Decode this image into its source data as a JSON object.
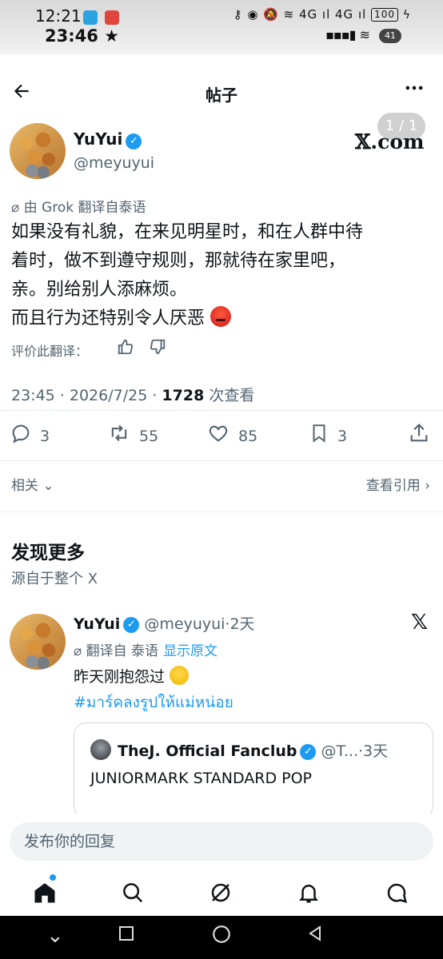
{
  "status_bar": {
    "time_primary": "12:21",
    "time_secondary": "23:46",
    "icons_top": "⚷ ◉ 🔕 ≋ 4G ıl 4G ıl",
    "battery": "100",
    "battery_secondary": "41"
  },
  "header": {
    "title": "帖子",
    "page_indicator": "1 / 1"
  },
  "tweet": {
    "display_name": "YuYui",
    "handle": "@meyuyui",
    "source_logo": "𝕏.com",
    "translated_note": "由 Grok 翻译自泰语",
    "text_lines": [
      "如果没有礼貌，在来见明星时，和在人群中待",
      "着时，做不到遵守规则，那就待在家里吧，",
      "亲。别给别人添麻烦。",
      "而且行为还特别令人厌恶"
    ],
    "rate_label": "评价此翻译：",
    "timestamp": "23:45 · 2026/7/25 · ",
    "views_count": "1728",
    "views_label": " 次查看",
    "replies": "3",
    "retweets": "55",
    "likes": "85",
    "bookmarks": "3",
    "related_label": "相关",
    "view_quotes_label": "查看引用"
  },
  "discover": {
    "title": "发现更多",
    "subtitle": "源自于整个 X"
  },
  "tweet2": {
    "display_name": "YuYui",
    "handle_time": "@meyuyui·2天",
    "translated_note": "翻译自 泰语",
    "show_original": "显示原文",
    "text": "昨天刚抱怨过",
    "hashtag": "#มาร์คลงรูปให้แม่หน่อย",
    "quote": {
      "display_name": "TheJ. Official Fanclub",
      "handle_time": "@T...·3天",
      "text": "JUNIORMARK STANDARD POP"
    }
  },
  "reply_bar": {
    "placeholder": "发布你的回复"
  },
  "colors": {
    "accent": "#1d9bf0",
    "secondary_text": "#536471",
    "primary_text": "#0f1419"
  },
  "icons": {
    "back": "back-arrow-icon",
    "more": "more-dots-icon",
    "verified": "verified-badge-icon",
    "reply": "reply-icon",
    "retweet": "retweet-icon",
    "like": "heart-icon",
    "bookmark": "bookmark-icon",
    "share": "share-icon",
    "home": "home-icon",
    "search": "search-icon",
    "grok": "grok-icon",
    "notifications": "bell-icon",
    "messages": "message-icon"
  }
}
